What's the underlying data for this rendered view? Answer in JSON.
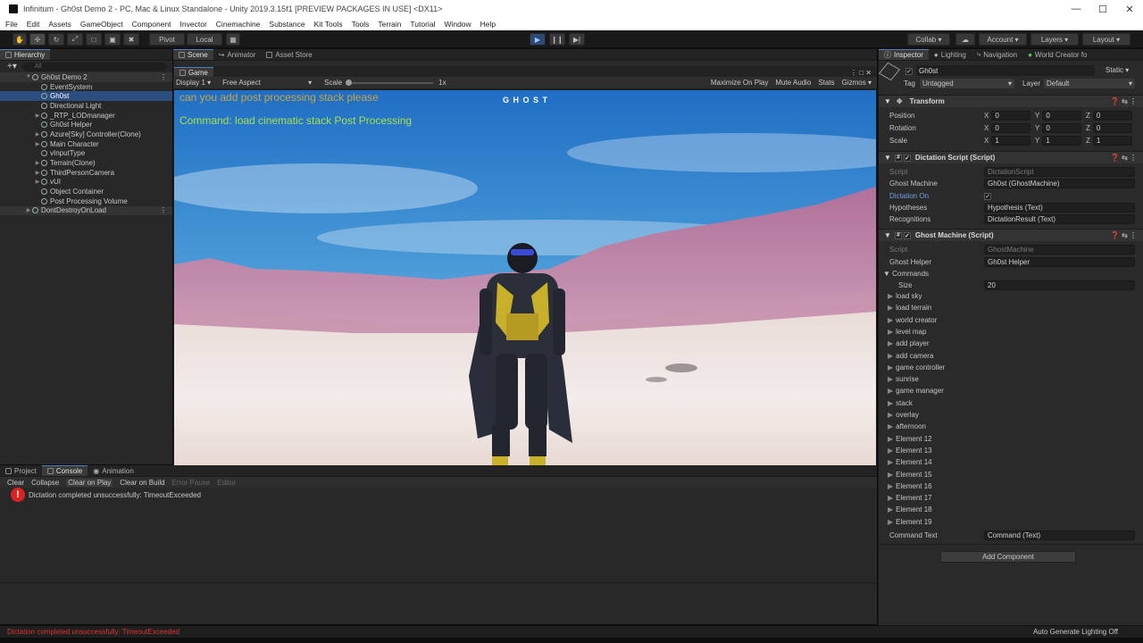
{
  "window": {
    "title": "Infinitum - Gh0st Demo 2 - PC, Mac & Linux Standalone - Unity 2019.3.15f1 [PREVIEW PACKAGES IN USE] <DX11>"
  },
  "menu": [
    "File",
    "Edit",
    "Assets",
    "GameObject",
    "Component",
    "Invector",
    "Cinemachine",
    "Substance",
    "Kit Tools",
    "Tools",
    "Terrain",
    "Tutorial",
    "Window",
    "Help"
  ],
  "toolbar": {
    "pivot": "Pivot",
    "local": "Local",
    "collab": "Collab",
    "account": "Account",
    "layers": "Layers",
    "layout": "Layout"
  },
  "hierarchy": {
    "tab": "Hierarchy",
    "search_placeholder": "All",
    "scene": "Gh0st Demo 2",
    "items": [
      {
        "label": "EventSystem",
        "sel": false
      },
      {
        "label": "Gh0st",
        "sel": true
      },
      {
        "label": "Directional Light",
        "sel": false
      },
      {
        "label": "_RTP_LODmanager",
        "sel": false
      },
      {
        "label": "Gh0st Helper",
        "sel": false
      },
      {
        "label": "Azure[Sky] Controller(Clone)",
        "sel": false
      },
      {
        "label": "Main Character",
        "sel": false
      },
      {
        "label": "vInputType",
        "sel": false
      },
      {
        "label": "Terrain(Clone)",
        "sel": false
      },
      {
        "label": "ThirdPersonCamera",
        "sel": false
      },
      {
        "label": "vUI",
        "sel": false
      },
      {
        "label": "Object Container",
        "sel": false
      },
      {
        "label": "Post Processing Volume",
        "sel": false
      }
    ],
    "dontdestroy": "DontDestroyOnLoad"
  },
  "center": {
    "tabs": [
      "Scene",
      "Animator",
      "Asset Store"
    ],
    "game_tab": "Game",
    "display": "Display 1",
    "aspect": "Free Aspect",
    "scale_label": "Scale",
    "scale_value": "1x",
    "maximize": "Maximize On Play",
    "mute": "Mute Audio",
    "stats": "Stats",
    "gizmos": "Gizmos"
  },
  "game": {
    "hypothesis": "can you add post processing stack please",
    "command": "Command: load cinematic stack  Post Processing",
    "logo": "G H O S T",
    "colors": {
      "hypothesis": "#c9a53a",
      "command": "#a6e04a"
    }
  },
  "console": {
    "tabs": [
      "Project",
      "Console",
      "Animation"
    ],
    "buttons": [
      "Clear",
      "Collapse",
      "Clear on Play",
      "Clear on Build",
      "Error Pause",
      "Editor"
    ],
    "message": "Dictation completed unsuccessfully: TimeoutExceeded"
  },
  "status": {
    "left": "Dictation completed unsuccessfully: TimeoutExceeded",
    "right": "Auto Generate Lighting Off"
  },
  "inspector": {
    "tabs": [
      "Inspector",
      "Lighting",
      "Navigation",
      "World Creator fo"
    ],
    "object_name": "Gh0st",
    "static": "Static",
    "tag_label": "Tag",
    "tag_value": "Untagged",
    "layer_label": "Layer",
    "layer_value": "Default",
    "transform": {
      "title": "Transform",
      "rows": [
        {
          "label": "Position",
          "x": "0",
          "y": "0",
          "z": "0"
        },
        {
          "label": "Rotation",
          "x": "0",
          "y": "0",
          "z": "0"
        },
        {
          "label": "Scale",
          "x": "1",
          "y": "1",
          "z": "1"
        }
      ]
    },
    "dictation": {
      "title": "Dictation Script (Script)",
      "script_label": "Script",
      "script_value": "DictationScript",
      "ghost_machine_label": "Ghost Machine",
      "ghost_machine_value": "Gh0st (GhostMachine)",
      "dictation_on_label": "Dictation On",
      "hypotheses_label": "Hypotheses",
      "hypotheses_value": "Hypothesis (Text)",
      "recognitions_label": "Recognitions",
      "recognitions_value": "DictationResult (Text)"
    },
    "ghostmachine": {
      "title": "Ghost Machine (Script)",
      "script_label": "Script",
      "script_value": "GhostMachine",
      "helper_label": "Ghost Helper",
      "helper_value": "Gh0st Helper",
      "commands_label": "Commands",
      "size_label": "Size",
      "size_value": "20",
      "commands": [
        "load sky",
        "load terrain",
        "world creator",
        "level map",
        "add player",
        "add camera",
        "game controller",
        "sunrise",
        "game manager",
        "stack",
        "overlay",
        "afternoon",
        "Element 12",
        "Element 13",
        "Element 14",
        "Element 15",
        "Element 16",
        "Element 17",
        "Element 18",
        "Element 19"
      ],
      "command_text_label": "Command Text",
      "command_text_value": "Command (Text)"
    },
    "add_component": "Add Component"
  }
}
